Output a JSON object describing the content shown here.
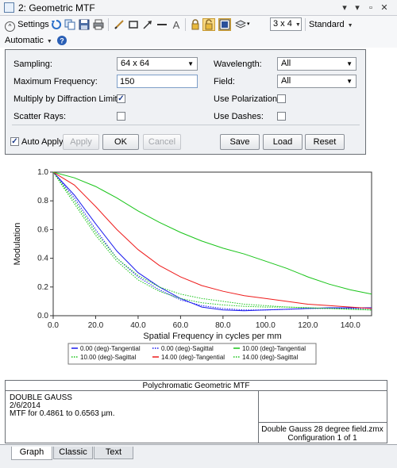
{
  "window": {
    "title": "2: Geometric MTF",
    "controls": [
      "▾",
      "▾",
      "▫",
      "✕"
    ]
  },
  "toolbar": {
    "settings_label": "Settings",
    "grid_select": "3 x 4",
    "style_select": "Standard",
    "automatic_label": "Automatic",
    "icons": [
      "refresh-icon",
      "copy-icon",
      "save-icon",
      "print-icon",
      "pencil-icon",
      "rectangle-icon",
      "arrow-icon",
      "line-icon",
      "text-icon",
      "lock-icon",
      "lock-open-icon",
      "window-icon",
      "layers-icon",
      "help-icon"
    ]
  },
  "settings": {
    "sampling_label": "Sampling:",
    "sampling_value": "64 x 64",
    "max_freq_label": "Maximum Frequency:",
    "max_freq_value": "150",
    "multiply_label": "Multiply by Diffraction Limit:",
    "multiply_checked": true,
    "scatter_label": "Scatter Rays:",
    "scatter_checked": false,
    "wavelength_label": "Wavelength:",
    "wavelength_value": "All",
    "field_label": "Field:",
    "field_value": "All",
    "polarization_label": "Use Polarization:",
    "polarization_checked": false,
    "dashes_label": "Use Dashes:",
    "dashes_checked": false,
    "auto_apply_label": "Auto Apply",
    "auto_apply_checked": true,
    "apply_label": "Apply",
    "ok_label": "OK",
    "cancel_label": "Cancel",
    "save_label": "Save",
    "load_label": "Load",
    "reset_label": "Reset"
  },
  "chart_data": {
    "type": "line",
    "xlabel": "Spatial Frequency in cycles per mm",
    "ylabel": "Modulation",
    "xlim": [
      0,
      150
    ],
    "ylim": [
      0,
      1.0
    ],
    "x_ticks": [
      "0.0",
      "20.0",
      "40.0",
      "60.0",
      "80.0",
      "100.0",
      "120.0",
      "140.0"
    ],
    "y_ticks": [
      "0.0",
      "0.2",
      "0.4",
      "0.6",
      "0.8",
      "1.0"
    ],
    "x": [
      0,
      10,
      20,
      30,
      40,
      50,
      60,
      70,
      80,
      90,
      100,
      110,
      120,
      130,
      140,
      150
    ],
    "series": [
      {
        "name": "0.00 (deg)-Tangential",
        "color": "#1a1aee",
        "dash": false,
        "values": [
          1.0,
          0.84,
          0.64,
          0.45,
          0.3,
          0.2,
          0.12,
          0.06,
          0.04,
          0.035,
          0.04,
          0.045,
          0.05,
          0.055,
          0.055,
          0.055
        ]
      },
      {
        "name": "0.00 (deg)-Sagittal",
        "color": "#1a1aee",
        "dash": true,
        "values": [
          1.0,
          0.82,
          0.6,
          0.4,
          0.27,
          0.18,
          0.11,
          0.07,
          0.05,
          0.04,
          0.04,
          0.045,
          0.05,
          0.05,
          0.05,
          0.05
        ]
      },
      {
        "name": "10.00 (deg)-Tangential",
        "color": "#18c418",
        "dash": false,
        "values": [
          1.0,
          0.96,
          0.9,
          0.82,
          0.73,
          0.65,
          0.58,
          0.52,
          0.47,
          0.43,
          0.38,
          0.33,
          0.27,
          0.22,
          0.18,
          0.15
        ]
      },
      {
        "name": "10.00 (deg)-Sagittal",
        "color": "#18c418",
        "dash": true,
        "values": [
          1.0,
          0.78,
          0.56,
          0.38,
          0.25,
          0.17,
          0.12,
          0.09,
          0.075,
          0.065,
          0.06,
          0.06,
          0.055,
          0.05,
          0.045,
          0.04
        ]
      },
      {
        "name": "14.00 (deg)-Tangential",
        "color": "#ee1a1a",
        "dash": false,
        "values": [
          1.0,
          0.91,
          0.76,
          0.6,
          0.46,
          0.35,
          0.27,
          0.21,
          0.17,
          0.14,
          0.12,
          0.1,
          0.08,
          0.07,
          0.06,
          0.05
        ]
      },
      {
        "name": "14.00 (deg)-Sagittal",
        "color": "#18c418",
        "dash": true,
        "values": [
          1.0,
          0.8,
          0.58,
          0.4,
          0.28,
          0.2,
          0.15,
          0.12,
          0.1,
          0.08,
          0.07,
          0.06,
          0.055,
          0.05,
          0.045,
          0.04
        ]
      }
    ]
  },
  "footer": {
    "title": "Polychromatic Geometric MTF",
    "lines": [
      "DOUBLE GAUSS",
      "2/6/2014",
      "MTF for 0.4861 to 0.6563 µm."
    ],
    "file": "Double Gauss 28 degree field.zmx",
    "config": "Configuration 1 of 1"
  },
  "tabs": [
    {
      "label": "Graph",
      "active": true
    },
    {
      "label": "Classic",
      "active": false
    },
    {
      "label": "Text",
      "active": false
    }
  ]
}
